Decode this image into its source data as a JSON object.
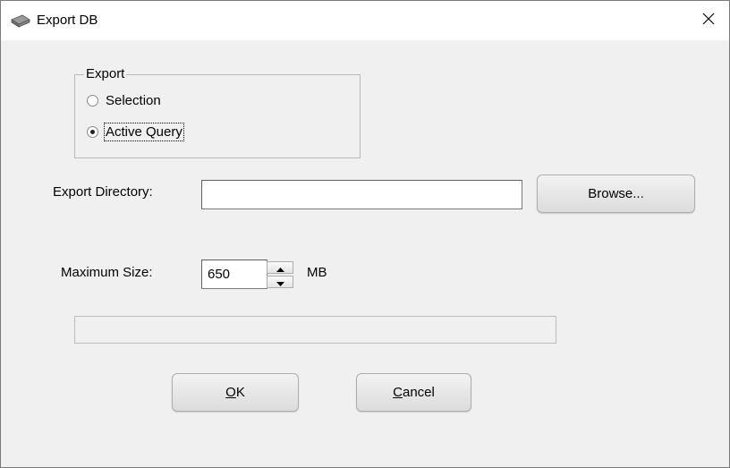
{
  "window": {
    "title": "Export DB",
    "title_icon": "disk-drive-icon",
    "close_icon": "close-icon"
  },
  "export_group": {
    "legend": "Export",
    "options": [
      {
        "label": "Selection",
        "checked": false
      },
      {
        "label": "Active Query",
        "checked": true
      }
    ]
  },
  "directory": {
    "label": "Export Directory:",
    "value": "",
    "browse_label": "Browse..."
  },
  "max_size": {
    "label": "Maximum Size:",
    "value": "650",
    "unit": "MB"
  },
  "progress": {
    "fraction": 0
  },
  "buttons": {
    "ok_mnemonic": "O",
    "ok_rest": "K",
    "cancel_mnemonic": "C",
    "cancel_rest": "ancel"
  },
  "colors": {
    "dialog_bg": "#f0f0f0",
    "titlebar_bg": "#ffffff",
    "button_face": "#e1e1e1",
    "progress_fill": "#06b025"
  }
}
